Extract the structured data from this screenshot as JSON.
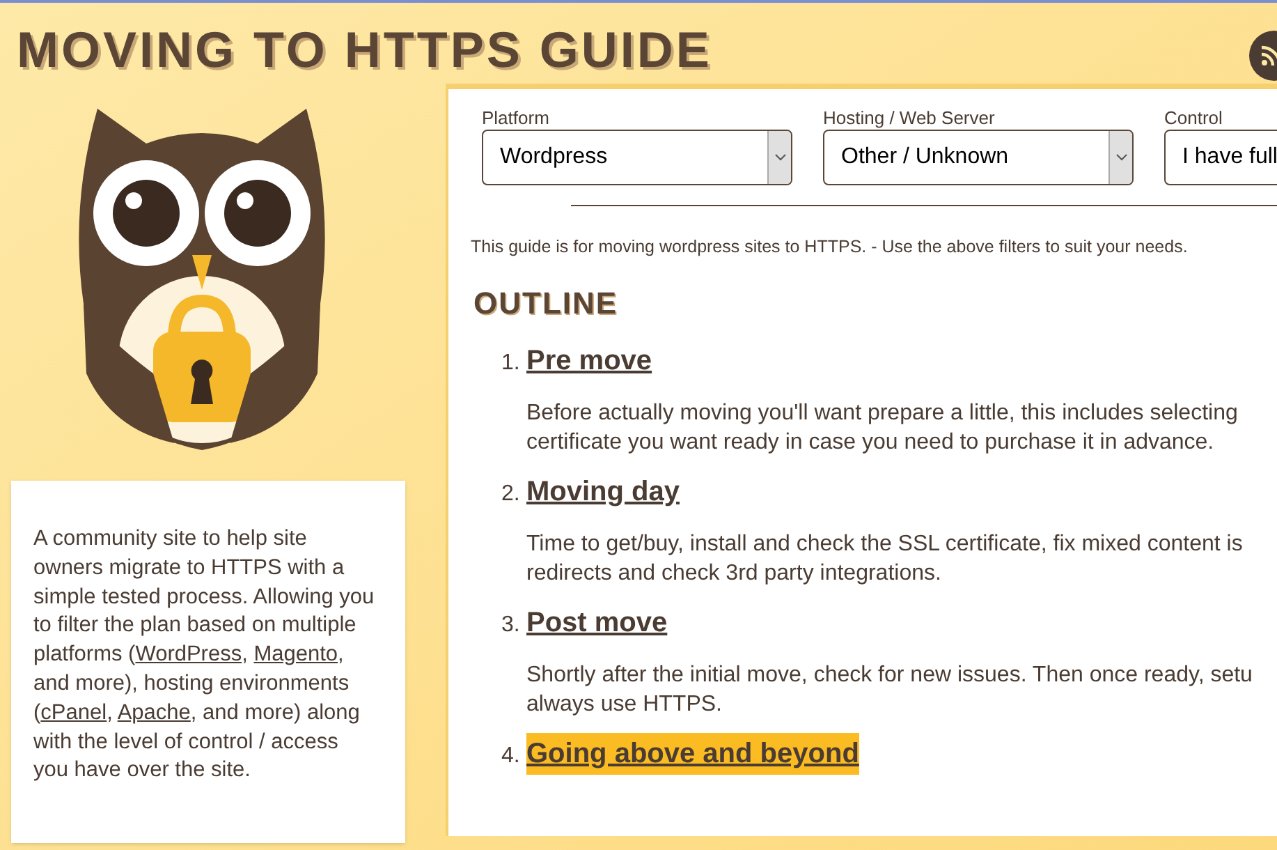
{
  "header": {
    "title": "MOVING TO HTTPS GUIDE"
  },
  "intro": [
    {
      "kind": "text",
      "text": "A community site to help site owners migrate to HTTPS with a simple tested process. Allowing you to filter the plan based on multiple platforms ("
    },
    {
      "kind": "link",
      "text": "WordPress"
    },
    {
      "kind": "text",
      "text": ", "
    },
    {
      "kind": "link",
      "text": "Magento"
    },
    {
      "kind": "text",
      "text": ", and more), hosting environments ("
    },
    {
      "kind": "link",
      "text": "cPanel"
    },
    {
      "kind": "text",
      "text": ", "
    },
    {
      "kind": "link",
      "text": "Apache"
    },
    {
      "kind": "text",
      "text": ", and more) along with the level of control / access you have over the site."
    }
  ],
  "filters": [
    {
      "label": "Platform",
      "value": "Wordpress"
    },
    {
      "label": "Hosting / Web Server",
      "value": "Other / Unknown"
    },
    {
      "label": "Control",
      "value": "I have full"
    }
  ],
  "summary": "This guide is for moving wordpress sites to HTTPS. - Use the above filters to suit your needs.",
  "outline": {
    "heading": "OUTLINE",
    "steps": [
      {
        "number": "1.",
        "title": "Pre move",
        "highlighted": false,
        "lines": [
          "Before actually moving you'll want prepare a little, this includes selecting",
          "certificate you want ready in case you need to purchase it in advance."
        ]
      },
      {
        "number": "2.",
        "title": "Moving day",
        "highlighted": false,
        "lines": [
          "Time to get/buy, install and check the SSL certificate, fix mixed content is",
          "redirects and check 3rd party integrations."
        ]
      },
      {
        "number": "3.",
        "title": "Post move",
        "highlighted": false,
        "lines": [
          "Shortly after the initial move, check for new issues. Then once ready, setu",
          "always use HTTPS."
        ]
      },
      {
        "number": "4.",
        "title": "Going above and beyond",
        "highlighted": true
      }
    ]
  }
}
